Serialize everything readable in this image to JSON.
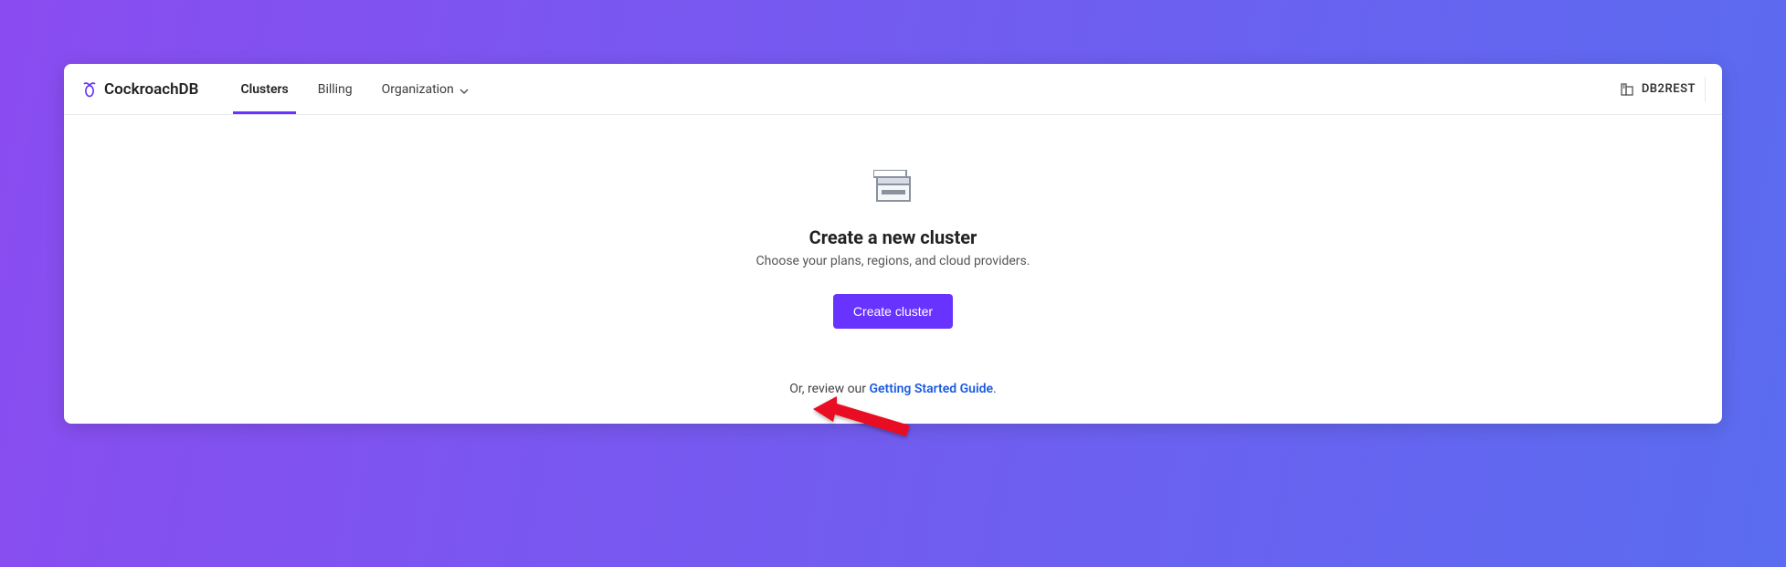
{
  "brand": {
    "name": "CockroachDB"
  },
  "nav": {
    "clusters": "Clusters",
    "billing": "Billing",
    "organization": "Organization"
  },
  "org_switcher": {
    "label": "DB2REST"
  },
  "empty_state": {
    "title": "Create a new cluster",
    "subtitle": "Choose your plans, regions, and cloud providers.",
    "button_label": "Create cluster",
    "guide_prefix": "Or, review our ",
    "guide_link": "Getting Started Guide",
    "guide_suffix": "."
  }
}
